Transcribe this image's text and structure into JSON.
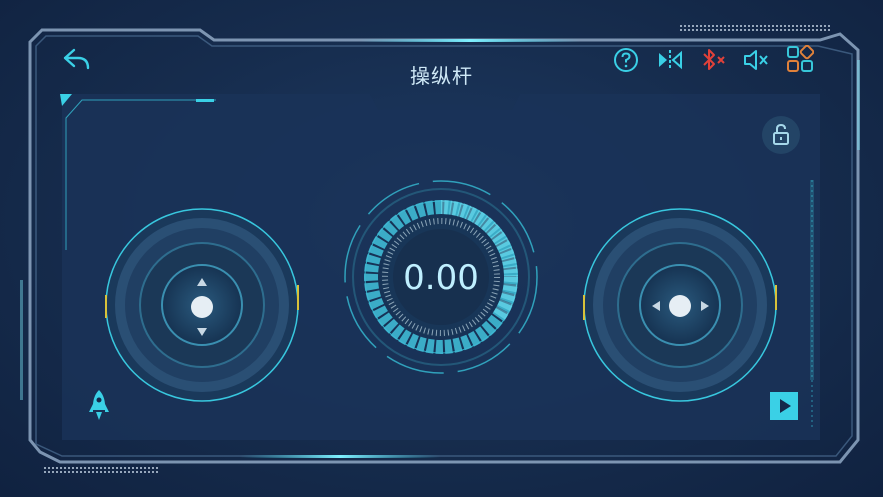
{
  "header": {
    "title": "操纵杆"
  },
  "gauge": {
    "value": "0.00"
  },
  "colors": {
    "accent": "#3ad0e6",
    "bluetooth_off": "#e0413a",
    "panel": "#1b3457",
    "joystick_marker": "#d8c23a",
    "layout_icon_teal": "#37c6d8",
    "layout_icon_orange": "#e0813a"
  },
  "icons": {
    "back": "back-arrow-icon",
    "help": "help-icon",
    "mirror": "mirror-flip-icon",
    "bluetooth": "bluetooth-disconnected-icon",
    "sound": "sound-muted-icon",
    "layout": "layout-grid-icon",
    "lock": "unlock-icon",
    "rocket": "rocket-icon",
    "play": "play-icon"
  }
}
